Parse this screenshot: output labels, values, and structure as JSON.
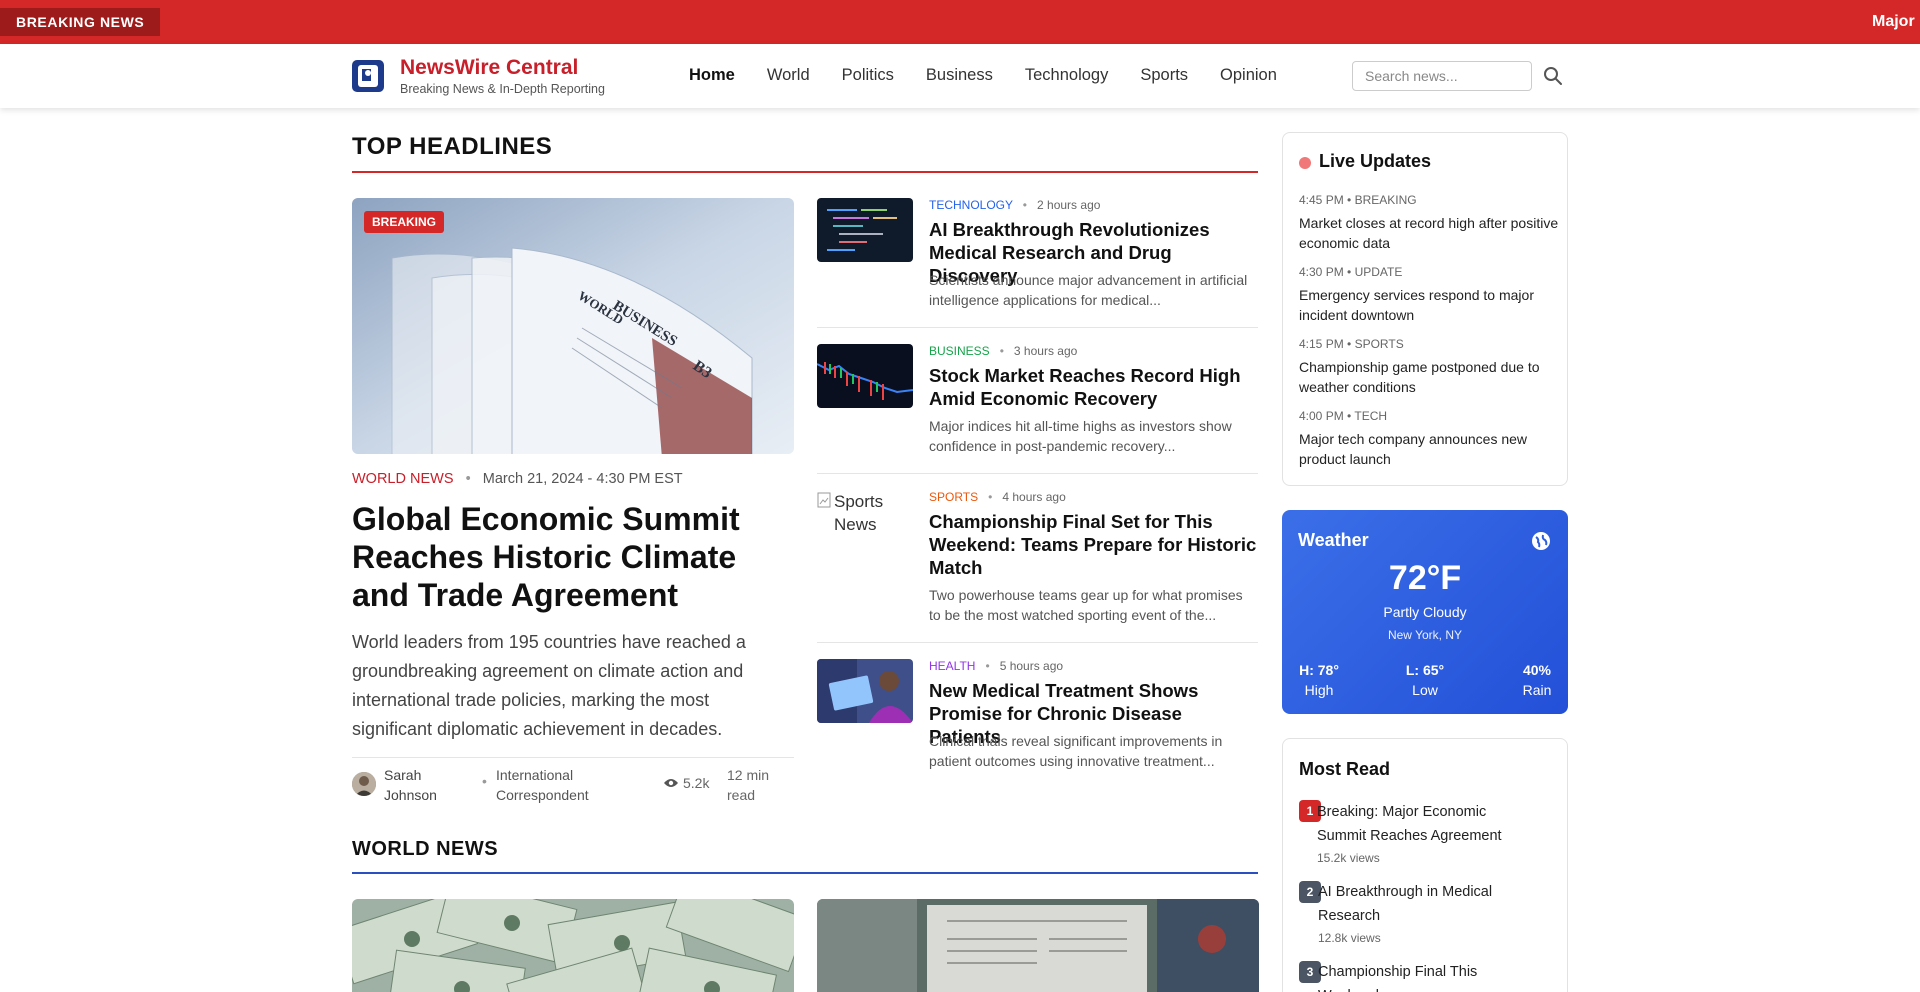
{
  "ticker": {
    "badge": "BREAKING NEWS",
    "text": "Major E"
  },
  "header": {
    "site_name": "NewsWire Central",
    "tagline": "Breaking News & In-Depth Reporting",
    "nav": [
      "Home",
      "World",
      "Politics",
      "Business",
      "Technology",
      "Sports",
      "Opinion"
    ],
    "active_nav": "Home",
    "search_placeholder": "Search news..."
  },
  "top_headlines": {
    "title": "TOP HEADLINES",
    "feature": {
      "badge": "BREAKING",
      "category": "WORLD NEWS",
      "date": "March 21, 2024 - 4:30 PM EST",
      "title": "Global Economic Summit Reaches Historic Climate and Trade Agreement",
      "summary": "World leaders from 195 countries have reached a groundbreaking agreement on climate action and international trade policies, marking the most significant diplomatic achievement in decades.",
      "author": "Sarah Johnson",
      "author_role": "International Correspondent",
      "views": "5.2k",
      "read_time": "12 min read",
      "image_words": [
        "WORLD",
        "BUSINESS",
        "B3"
      ]
    },
    "articles": [
      {
        "category": "TECHNOLOGY",
        "category_color": "#2563eb",
        "time": "2 hours ago",
        "title": "AI Breakthrough Revolutionizes Medical Research and Drug Discovery",
        "desc": "Scientists announce major advancement in artificial intelligence applications for medical..."
      },
      {
        "category": "BUSINESS",
        "category_color": "#16a34a",
        "time": "3 hours ago",
        "title": "Stock Market Reaches Record High Amid Economic Recovery",
        "desc": "Major indices hit all-time highs as investors show confidence in post-pandemic recovery..."
      },
      {
        "category": "SPORTS",
        "category_color": "#ea580c",
        "time": "4 hours ago",
        "title": "Championship Final Set for This Weekend: Teams Prepare for Historic Match",
        "desc": "Two powerhouse teams gear up for what promises to be the most watched sporting event of the...",
        "broken_image_alt": "Sports News"
      },
      {
        "category": "HEALTH",
        "category_color": "#9333ea",
        "time": "5 hours ago",
        "title": "New Medical Treatment Shows Promise for Chronic Disease Patients",
        "desc": "Clinical trials reveal significant improvements in patient outcomes using innovative treatment..."
      }
    ]
  },
  "world_news": {
    "title": "WORLD NEWS"
  },
  "live_updates": {
    "title": "Live Updates",
    "items": [
      {
        "time": "4:45 PM",
        "tag": "BREAKING",
        "text": "Market closes at record high after positive economic data"
      },
      {
        "time": "4:30 PM",
        "tag": "UPDATE",
        "text": "Emergency services respond to major incident downtown"
      },
      {
        "time": "4:15 PM",
        "tag": "SPORTS",
        "text": "Championship game postponed due to weather conditions"
      },
      {
        "time": "4:00 PM",
        "tag": "TECH",
        "text": "Major tech company announces new product launch"
      }
    ]
  },
  "weather": {
    "title": "Weather",
    "temp": "72°F",
    "condition": "Partly Cloudy",
    "location": "New York, NY",
    "high": "H: 78°",
    "high_label": "High",
    "low": "L: 65°",
    "low_label": "Low",
    "rain": "40%",
    "rain_label": "Rain"
  },
  "most_read": {
    "title": "Most Read",
    "items": [
      {
        "rank": "1",
        "title": "Breaking: Major Economic Summit Reaches Agreement",
        "views": "15.2k views",
        "color": "#d42727"
      },
      {
        "rank": "2",
        "title": "AI Breakthrough in Medical Research",
        "views": "12.8k views",
        "color": "#4b5563"
      },
      {
        "rank": "3",
        "title": "Championship Final This Weekend",
        "views": "",
        "color": "#4b5563"
      }
    ]
  },
  "colors": {
    "brand_red": "#d42727",
    "world_news_rule": "#2a4fc0",
    "weather_blue": "#2d5ee0"
  }
}
